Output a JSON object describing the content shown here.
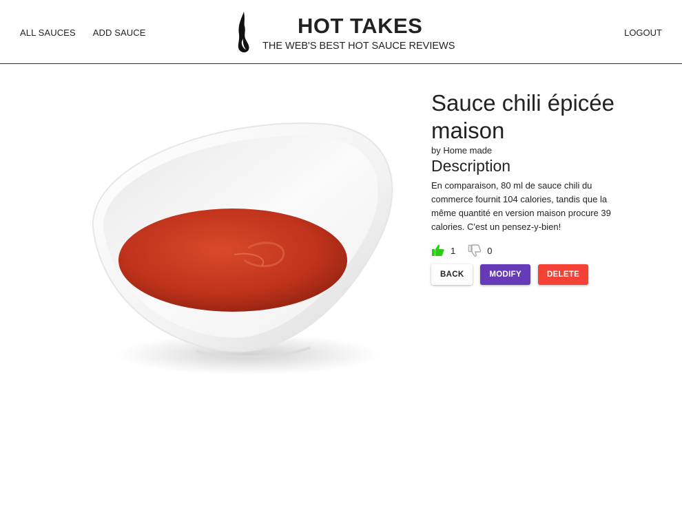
{
  "header": {
    "nav": {
      "all_sauces": "ALL SAUCES",
      "add_sauce": "ADD SAUCE",
      "logout": "LOGOUT"
    },
    "brand": {
      "title": "HOT TAKES",
      "subtitle": "THE WEB'S BEST HOT SAUCE REVIEWS",
      "logo_icon": "flame-icon"
    }
  },
  "sauce": {
    "name": "Sauce chili épicée maison",
    "manufacturer": "by Home made",
    "description_heading": "Description",
    "description": "En comparaison, 80 ml de sauce chili du commerce fournit 104 calories, tandis que la même quantité en version maison procure 39 calories. C'est un pensez-y-bien!",
    "likes": "1",
    "dislikes": "0",
    "image_icon": "sauce-bowl-image"
  },
  "actions": {
    "back": "BACK",
    "modify": "MODIFY",
    "delete": "DELETE"
  },
  "colors": {
    "like": "#2ecc1a",
    "dislike": "#bbbbbb",
    "modify": "#673ab7",
    "delete": "#f44336",
    "sauce": "#c0331c"
  }
}
